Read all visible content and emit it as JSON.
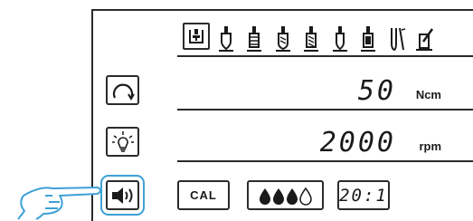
{
  "tools": [
    {
      "icon": "contra-angle-selected-icon",
      "selected": true
    },
    {
      "icon": "implant-drill-1-icon"
    },
    {
      "icon": "implant-drill-2-icon"
    },
    {
      "icon": "implant-drill-3-icon"
    },
    {
      "icon": "implant-drill-4-icon"
    },
    {
      "icon": "implant-drill-5-icon"
    },
    {
      "icon": "implant-drill-6-icon"
    },
    {
      "icon": "implant-tools-icon"
    },
    {
      "icon": "implant-surgery-icon"
    }
  ],
  "torque": {
    "value": "50",
    "unit": "Ncm"
  },
  "speed": {
    "value": "2000",
    "unit": "rpm"
  },
  "bottom": {
    "cal_label": "CAL",
    "ratio_label": "20:1",
    "irrigation_level": 3,
    "irrigation_max": 4
  },
  "colors": {
    "accent": "#3ea0d6",
    "line": "#2b2b2b"
  }
}
